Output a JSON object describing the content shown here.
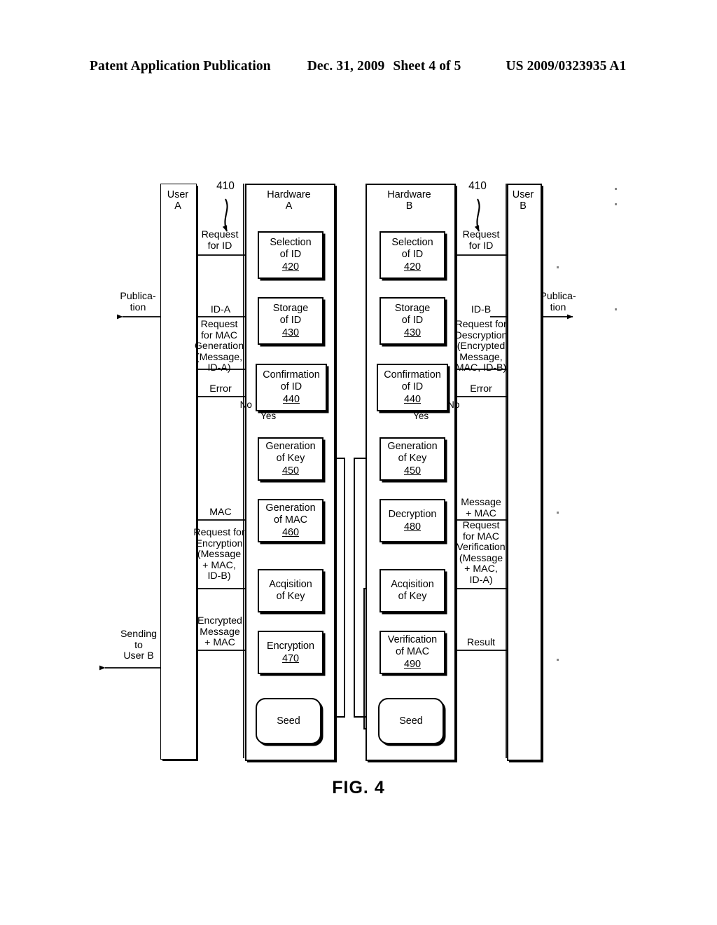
{
  "header": {
    "publication": "Patent Application Publication",
    "date": "Dec. 31, 2009",
    "sheet": "Sheet 4 of 5",
    "doc_number": "US 2009/0323935 A1"
  },
  "figure": {
    "caption": "FIG. 4",
    "lanes": [
      {
        "id": "user-a",
        "label": "User\nA"
      },
      {
        "id": "hardware-a",
        "label": "Hardware\nA"
      },
      {
        "id": "hardware-b",
        "label": "Hardware\nB"
      },
      {
        "id": "user-b",
        "label": "User\nB"
      }
    ],
    "callouts": [
      {
        "id": "callout-410-left",
        "text": "410"
      },
      {
        "id": "callout-410-right",
        "text": "410"
      }
    ],
    "boxes_left": [
      {
        "id": "selection-of-id-a",
        "title": "Selection\nof ID",
        "ref": "420"
      },
      {
        "id": "storage-of-id-a",
        "title": "Storage\nof ID",
        "ref": "430"
      },
      {
        "id": "confirmation-of-id-a",
        "title": "Confirmation\nof ID",
        "ref": "440"
      },
      {
        "id": "generation-of-key-a",
        "title": "Generation\nof Key",
        "ref": "450"
      },
      {
        "id": "generation-of-mac-a",
        "title": "Generation\nof MAC",
        "ref": "460"
      },
      {
        "id": "acquisition-of-key-a",
        "title": "Acqisition\nof Key",
        "ref": ""
      },
      {
        "id": "encryption-a",
        "title": "Encryption",
        "ref": "470"
      },
      {
        "id": "seed-a",
        "title": "Seed",
        "ref": ""
      }
    ],
    "boxes_right": [
      {
        "id": "selection-of-id-b",
        "title": "Selection\nof ID",
        "ref": "420"
      },
      {
        "id": "storage-of-id-b",
        "title": "Storage\nof ID",
        "ref": "430"
      },
      {
        "id": "confirmation-of-id-b",
        "title": "Confirmation\nof ID",
        "ref": "440"
      },
      {
        "id": "generation-of-key-b",
        "title": "Generation\nof Key",
        "ref": "450"
      },
      {
        "id": "decryption-b",
        "title": "Decryption",
        "ref": "480"
      },
      {
        "id": "acquisition-of-key-b",
        "title": "Acqisition\nof Key",
        "ref": ""
      },
      {
        "id": "verification-of-mac-b",
        "title": "Verification\nof MAC",
        "ref": "490"
      },
      {
        "id": "seed-b",
        "title": "Seed",
        "ref": ""
      }
    ],
    "messages_left": [
      {
        "id": "request-for-id-a",
        "text": "Request\nfor ID"
      },
      {
        "id": "id-a",
        "text": "ID-A"
      },
      {
        "id": "request-for-mac-generation",
        "text": "Request\nfor MAC\nGeneration\n(Message,\nID-A)"
      },
      {
        "id": "error-a",
        "text": "Error"
      },
      {
        "id": "no-a",
        "text": "No"
      },
      {
        "id": "yes-a",
        "text": "Yes"
      },
      {
        "id": "mac-a",
        "text": "MAC"
      },
      {
        "id": "request-for-encryption",
        "text": "Request for\nEncryption\n(Message\n+ MAC,\nID-B)"
      },
      {
        "id": "encrypted-message-mac",
        "text": "Encrypted\nMessage\n+ MAC"
      }
    ],
    "messages_right": [
      {
        "id": "request-for-id-b",
        "text": "Request\nfor ID"
      },
      {
        "id": "id-b",
        "text": "ID-B"
      },
      {
        "id": "request-for-descryption",
        "text": "Request for\nDescryption\n(Encrypted\nMessage,\nMAC, ID-B)"
      },
      {
        "id": "error-b",
        "text": "Error"
      },
      {
        "id": "no-b",
        "text": "No"
      },
      {
        "id": "yes-b",
        "text": "Yes"
      },
      {
        "id": "message-mac-b",
        "text": "Message\n+ MAC"
      },
      {
        "id": "request-for-mac-verification",
        "text": "Request\nfor MAC\nVerification\n(Message\n+ MAC,\nID-A)"
      },
      {
        "id": "result-b",
        "text": "Result"
      }
    ],
    "outputs": [
      {
        "id": "publication-left",
        "text": "Publica-\ntion"
      },
      {
        "id": "publication-right",
        "text": "Publica-\ntion"
      },
      {
        "id": "sending-to-user-b",
        "text": "Sending\nto\nUser B"
      }
    ]
  }
}
